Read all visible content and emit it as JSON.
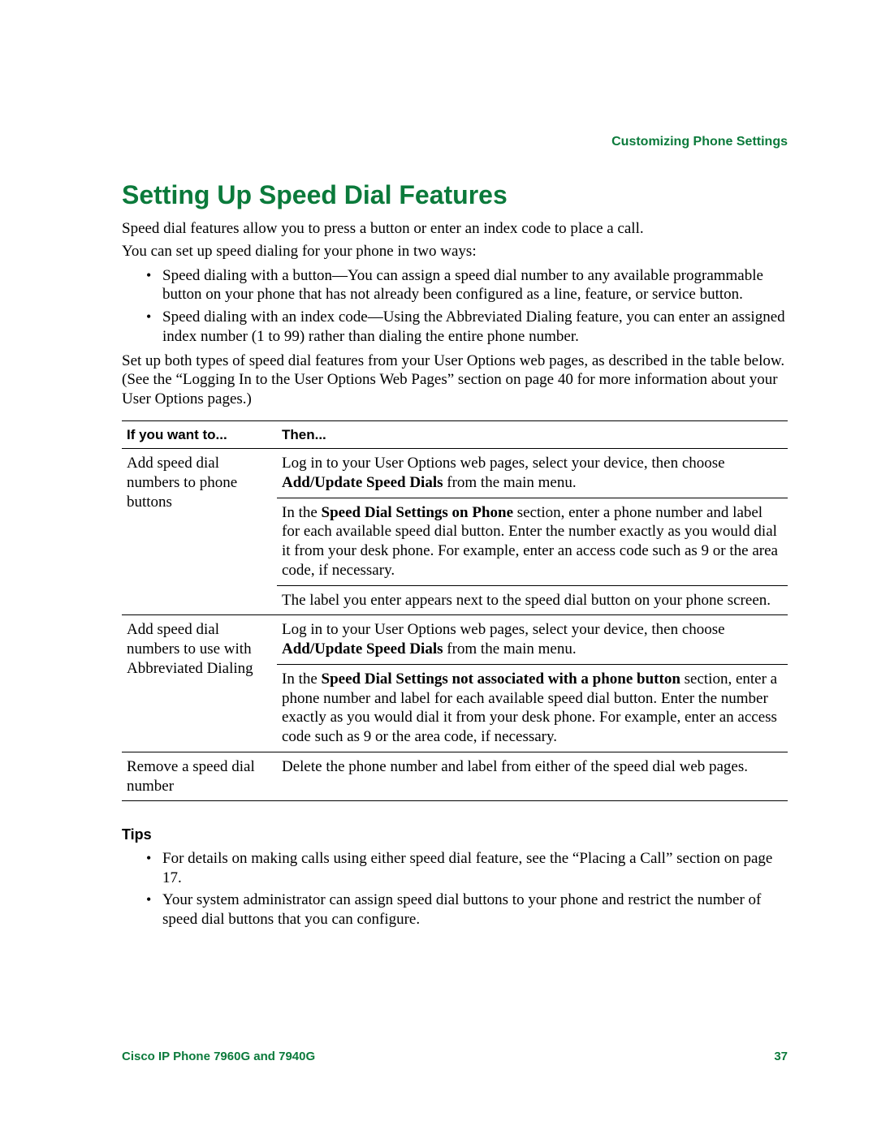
{
  "header": {
    "section_title": "Customizing Phone Settings"
  },
  "title": "Setting Up Speed Dial Features",
  "intro1": "Speed dial features allow you to press a button or enter an index code to place a call.",
  "intro2": "You can set up speed dialing for your phone in two ways:",
  "intro_bullets": [
    "Speed dialing with a button—You can assign a speed dial number to any available programmable button on your phone that has not already been configured as a line, feature, or service button.",
    "Speed dialing with an index code—Using the Abbreviated Dialing feature, you can enter an assigned index number (1 to 99) rather than dialing the entire phone number."
  ],
  "intro3": "Set up both types of speed dial features from your User Options web pages, as described in the table below. (See the “Logging In to the User Options Web Pages” section on page 40 for more information about your User Options pages.)",
  "table": {
    "headers": [
      "If you want to...",
      "Then..."
    ],
    "rows": [
      {
        "left": "Add speed dial numbers to phone buttons",
        "right": [
          {
            "pre": "Log in to your User Options web pages, select your device, then choose ",
            "bold": "Add/Update Speed Dials",
            "post": " from the main menu."
          },
          {
            "pre": "In the ",
            "bold": "Speed Dial Settings on Phone",
            "post": " section, enter a phone number and label for each available speed dial button. Enter the number exactly as you would dial it from your desk phone. For example, enter an access code such as 9 or the area code, if necessary."
          },
          {
            "pre": "The label you enter appears next to the speed dial button on your phone screen.",
            "bold": "",
            "post": ""
          }
        ]
      },
      {
        "left": "Add speed dial numbers to use with Abbreviated Dialing",
        "right": [
          {
            "pre": "Log in to your User Options web pages, select your device, then choose ",
            "bold": "Add/Update Speed Dials",
            "post": " from the main menu."
          },
          {
            "pre": "In the ",
            "bold": "Speed Dial Settings not associated with a phone button",
            "post": " section, enter a phone number and label for each available speed dial button. Enter the number exactly as you would dial it from your desk phone. For example, enter an access code such as 9 or the area code, if necessary."
          }
        ]
      },
      {
        "left": "Remove a speed dial number",
        "right": [
          {
            "pre": "Delete the phone number and label from either of the speed dial web pages.",
            "bold": "",
            "post": ""
          }
        ]
      }
    ]
  },
  "tips_heading": "Tips",
  "tips": [
    "For details on making calls using either speed dial feature, see the “Placing a Call” section on page 17.",
    "Your system administrator can assign speed dial buttons to your phone and restrict the number of speed dial buttons that you can configure."
  ],
  "footer": {
    "left": "Cisco IP Phone 7960G and 7940G",
    "right": "37"
  }
}
